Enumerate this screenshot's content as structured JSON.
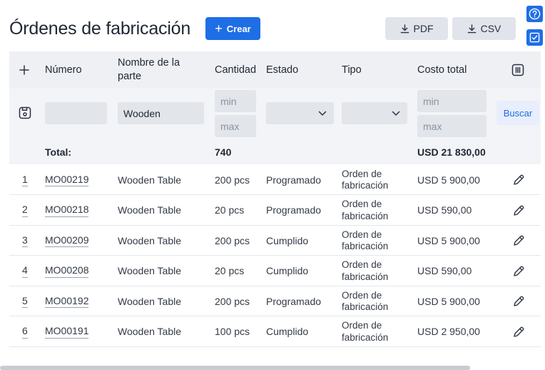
{
  "header": {
    "title": "Órdenes de fabricación",
    "create_label": "Crear",
    "pdf_label": "PDF",
    "csv_label": "CSV"
  },
  "side": {
    "help_icon": "help-circle-icon",
    "check_icon": "checkbox-icon"
  },
  "columns": {
    "number": "Número",
    "part_name": "Nombre de la parte",
    "quantity": "Cantidad",
    "status": "Estado",
    "type": "Tipo",
    "total_cost": "Costo total"
  },
  "filters": {
    "number": "",
    "part_name": "Wooden",
    "quantity_min_placeholder": "min",
    "quantity_max_placeholder": "max",
    "status": "",
    "type": "",
    "cost_min_placeholder": "min",
    "cost_max_placeholder": "max",
    "search_label": "Buscar"
  },
  "totals": {
    "label": "Total:",
    "quantity": "740",
    "cost": "USD 21 830,00"
  },
  "rows": [
    {
      "index": "1",
      "number": "MO00219",
      "part": "Wooden Table",
      "quantity": "200 pcs",
      "status": "Programado",
      "type": "Orden de fabricación",
      "cost": "USD 5 900,00"
    },
    {
      "index": "2",
      "number": "MO00218",
      "part": "Wooden Table",
      "quantity": "20 pcs",
      "status": "Programado",
      "type": "Orden de fabricación",
      "cost": "USD 590,00"
    },
    {
      "index": "3",
      "number": "MO00209",
      "part": "Wooden Table",
      "quantity": "200 pcs",
      "status": "Cumplido",
      "type": "Orden de fabricación",
      "cost": "USD 5 900,00"
    },
    {
      "index": "4",
      "number": "MO00208",
      "part": "Wooden Table",
      "quantity": "20 pcs",
      "status": "Cumplido",
      "type": "Orden de fabricación",
      "cost": "USD 590,00"
    },
    {
      "index": "5",
      "number": "MO00192",
      "part": "Wooden Table",
      "quantity": "200 pcs",
      "status": "Programado",
      "type": "Orden de fabricación",
      "cost": "USD 5 900,00"
    },
    {
      "index": "6",
      "number": "MO00191",
      "part": "Wooden Table",
      "quantity": "100 pcs",
      "status": "Cumplido",
      "type": "Orden de fabricación",
      "cost": "USD 2 950,00"
    }
  ],
  "colors": {
    "primary": "#1e6ee6",
    "header_bg": "#eef0f4",
    "button_gray": "#e1e4ea"
  }
}
